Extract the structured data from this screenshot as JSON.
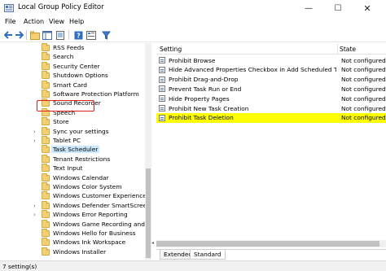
{
  "window": {
    "title": "Local Group Policy Editor",
    "controls": {
      "minimize": "—",
      "maximize": "☐",
      "close": "✕"
    }
  },
  "menu": [
    "File",
    "Action",
    "View",
    "Help"
  ],
  "toolbar": {
    "buttons": [
      "back-arrow-icon",
      "forward-arrow-icon",
      "up-folder-icon",
      "show-hide-tree-icon",
      "export-list-icon",
      "help-icon",
      "properties-icon",
      "filter-icon"
    ]
  },
  "tree": {
    "items": [
      {
        "label": "RSS Feeds",
        "expandable": false
      },
      {
        "label": "Search",
        "expandable": false
      },
      {
        "label": "Security Center",
        "expandable": false
      },
      {
        "label": "Shutdown Options",
        "expandable": false
      },
      {
        "label": "Smart Card",
        "expandable": false
      },
      {
        "label": "Software Protection Platform",
        "expandable": false
      },
      {
        "label": "Sound Recorder",
        "expandable": false
      },
      {
        "label": "Speech",
        "expandable": false
      },
      {
        "label": "Store",
        "expandable": false
      },
      {
        "label": "Sync your settings",
        "expandable": true
      },
      {
        "label": "Tablet PC",
        "expandable": true
      },
      {
        "label": "Task Scheduler",
        "expandable": false,
        "selected": true
      },
      {
        "label": "Tenant Restrictions",
        "expandable": false
      },
      {
        "label": "Text Input",
        "expandable": false
      },
      {
        "label": "Windows Calendar",
        "expandable": false
      },
      {
        "label": "Windows Color System",
        "expandable": false
      },
      {
        "label": "Windows Customer Experience Imp",
        "expandable": false
      },
      {
        "label": "Windows Defender SmartScreen",
        "expandable": true
      },
      {
        "label": "Windows Error Reporting",
        "expandable": true
      },
      {
        "label": "Windows Game Recording and Bro",
        "expandable": false
      },
      {
        "label": "Windows Hello for Business",
        "expandable": false
      },
      {
        "label": "Windows Ink Workspace",
        "expandable": false
      },
      {
        "label": "Windows Installer",
        "expandable": false
      }
    ]
  },
  "list": {
    "columns": {
      "setting": "Setting",
      "state": "State"
    },
    "rows": [
      {
        "name": "Prohibit Browse",
        "state": "Not configured"
      },
      {
        "name": "Hide Advanced Properties Checkbox in Add Scheduled Task ...",
        "state": "Not configured"
      },
      {
        "name": "Prohibit Drag-and-Drop",
        "state": "Not configured"
      },
      {
        "name": "Prevent Task Run or End",
        "state": "Not configured"
      },
      {
        "name": "Hide Property Pages",
        "state": "Not configured"
      },
      {
        "name": "Prohibit New Task Creation",
        "state": "Not configured"
      },
      {
        "name": "Prohibit Task Deletion",
        "state": "Not configured",
        "selected": true
      }
    ]
  },
  "tabs": [
    "Extended",
    "Standard"
  ],
  "status": {
    "text": "7 setting(s)"
  },
  "colors": {
    "selected_row": "#ffff00",
    "highlight_border": "#e02020",
    "folder": "#f3d173"
  }
}
